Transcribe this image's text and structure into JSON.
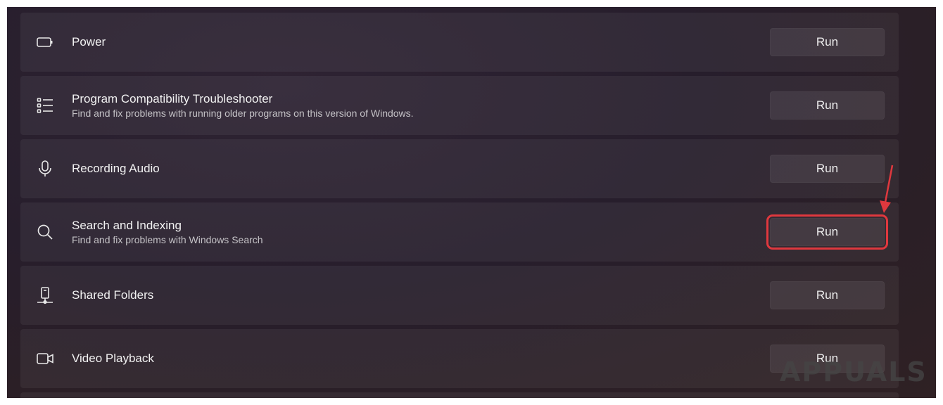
{
  "rows": [
    {
      "title": "Power",
      "desc": "",
      "icon": "battery-icon",
      "button": "Run"
    },
    {
      "title": "Program Compatibility Troubleshooter",
      "desc": "Find and fix problems with running older programs on this version of Windows.",
      "icon": "list-icon",
      "button": "Run"
    },
    {
      "title": "Recording Audio",
      "desc": "",
      "icon": "microphone-icon",
      "button": "Run"
    },
    {
      "title": "Search and Indexing",
      "desc": "Find and fix problems with Windows Search",
      "icon": "search-icon",
      "button": "Run"
    },
    {
      "title": "Shared Folders",
      "desc": "",
      "icon": "network-drive-icon",
      "button": "Run"
    },
    {
      "title": "Video Playback",
      "desc": "",
      "icon": "video-camera-icon",
      "button": "Run"
    }
  ],
  "highlight_color": "#e0383e",
  "watermark": "APPUALS"
}
